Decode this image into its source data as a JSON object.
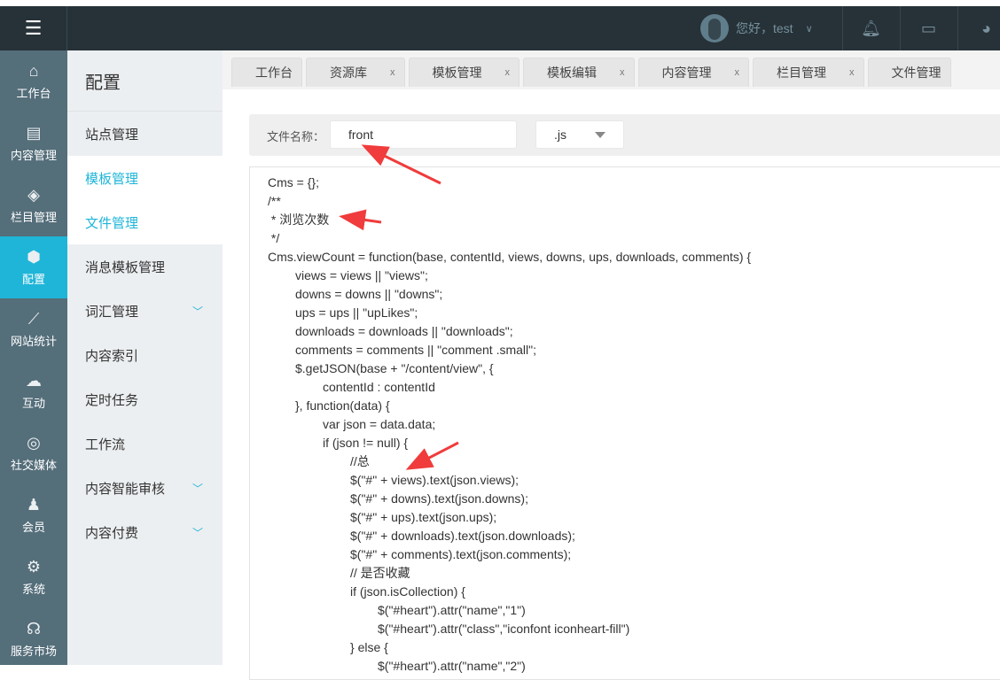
{
  "header": {
    "menu_icon": "hamburger-icon",
    "greeting": "您好，test"
  },
  "leftnav": [
    {
      "icon": "⌂",
      "label": "工作台"
    },
    {
      "icon": "▤",
      "label": "内容管理"
    },
    {
      "icon": "◈",
      "label": "栏目管理"
    },
    {
      "icon": "⬢",
      "label": "配置",
      "active": true
    },
    {
      "icon": "⟋",
      "label": "网站统计"
    },
    {
      "icon": "☁",
      "label": "互动"
    },
    {
      "icon": "◎",
      "label": "社交媒体"
    },
    {
      "icon": "♟",
      "label": "会员"
    },
    {
      "icon": "⚙",
      "label": "系统"
    },
    {
      "icon": "☊",
      "label": "服务市场"
    }
  ],
  "sub": {
    "title": "配置",
    "items": [
      {
        "label": "站点管理"
      },
      {
        "label": "模板管理",
        "sel": true
      },
      {
        "label": "文件管理",
        "sel": true
      },
      {
        "label": "消息模板管理"
      },
      {
        "label": "词汇管理",
        "chev": true
      },
      {
        "label": "内容索引"
      },
      {
        "label": "定时任务"
      },
      {
        "label": "工作流"
      },
      {
        "label": "内容智能审核",
        "chev": true
      },
      {
        "label": "内容付费",
        "chev": true
      }
    ]
  },
  "tabs": [
    {
      "label": "工作台"
    },
    {
      "label": "资源库",
      "close": "x"
    },
    {
      "label": "模板管理",
      "close": "x"
    },
    {
      "label": "模板编辑",
      "close": "x"
    },
    {
      "label": "内容管理",
      "close": "x"
    },
    {
      "label": "栏目管理",
      "close": "x"
    },
    {
      "label": "文件管理"
    }
  ],
  "file": {
    "label": "文件名称：",
    "name": "front",
    "ext": ".js"
  },
  "code": [
    [
      0,
      "Cms = {};"
    ],
    [
      0,
      "/**"
    ],
    [
      0,
      " * 浏览次数"
    ],
    [
      0,
      " */"
    ],
    [
      0,
      "Cms.viewCount = function(base, contentId, views, downs, ups, downloads, comments) {"
    ],
    [
      1,
      "views = views || \"views\";"
    ],
    [
      1,
      "downs = downs || \"downs\";"
    ],
    [
      1,
      "ups = ups || \"upLikes\";"
    ],
    [
      1,
      "downloads = downloads || \"downloads\";"
    ],
    [
      1,
      "comments = comments || \"comment .small\";"
    ],
    [
      1,
      "$.getJSON(base + \"/content/view\", {"
    ],
    [
      2,
      "contentId : contentId"
    ],
    [
      1,
      "}, function(data) {"
    ],
    [
      2,
      "var json = data.data;"
    ],
    [
      2,
      "if (json != null) {"
    ],
    [
      3,
      "//总"
    ],
    [
      3,
      "$(\"#\" + views).text(json.views);"
    ],
    [
      3,
      "$(\"#\" + downs).text(json.downs);"
    ],
    [
      3,
      "$(\"#\" + ups).text(json.ups);"
    ],
    [
      3,
      "$(\"#\" + downloads).text(json.downloads);"
    ],
    [
      3,
      "$(\"#\" + comments).text(json.comments);"
    ],
    [
      3,
      "// 是否收藏"
    ],
    [
      3,
      "if (json.isCollection) {"
    ],
    [
      4,
      "$(\"#heart\").attr(\"name\",\"1\")"
    ],
    [
      4,
      "$(\"#heart\").attr(\"class\",\"iconfont iconheart-fill\")"
    ],
    [
      3,
      "} else {"
    ],
    [
      4,
      "$(\"#heart\").attr(\"name\",\"2\")"
    ]
  ],
  "colors": {
    "accent": "#1fb5d8",
    "header": "#263238",
    "nav": "#546e7a",
    "arrow": "#f03c3c"
  }
}
